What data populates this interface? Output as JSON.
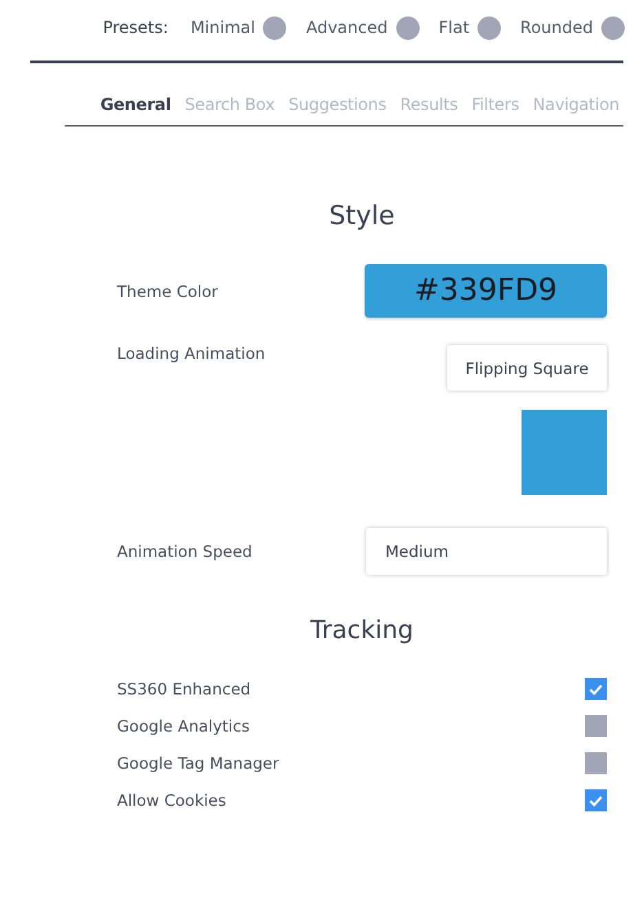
{
  "presets": {
    "label": "Presets:",
    "items": [
      {
        "label": "Minimal"
      },
      {
        "label": "Advanced"
      },
      {
        "label": "Flat"
      },
      {
        "label": "Rounded"
      }
    ]
  },
  "tabs": [
    {
      "label": "General",
      "selected": true
    },
    {
      "label": "Search Box",
      "selected": false
    },
    {
      "label": "Suggestions",
      "selected": false
    },
    {
      "label": "Results",
      "selected": false
    },
    {
      "label": "Filters",
      "selected": false
    },
    {
      "label": "Navigation",
      "selected": false
    }
  ],
  "style_section": {
    "title": "Style",
    "theme_color": {
      "label": "Theme Color",
      "value": "#339FD9"
    },
    "loading_animation": {
      "label": "Loading Animation",
      "value": "Flipping Square"
    },
    "animation_speed": {
      "label": "Animation Speed",
      "value": "Medium"
    }
  },
  "tracking_section": {
    "title": "Tracking",
    "items": [
      {
        "label": "SS360 Enhanced",
        "checked": true
      },
      {
        "label": "Google Analytics",
        "checked": false
      },
      {
        "label": "Google Tag Manager",
        "checked": false
      },
      {
        "label": "Allow Cookies",
        "checked": true
      }
    ]
  }
}
